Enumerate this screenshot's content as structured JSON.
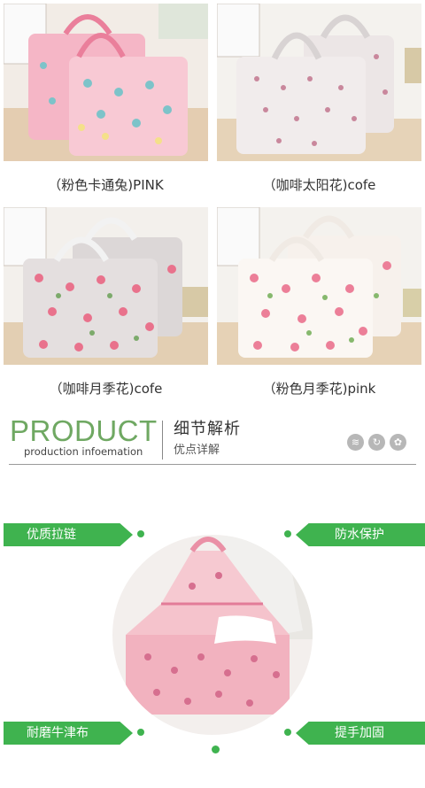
{
  "products": [
    {
      "caption": "（粉色卡通兔)PINK"
    },
    {
      "caption": "（咖啡太阳花)cofe"
    },
    {
      "caption": "（咖啡月季花)cofe"
    },
    {
      "caption": "（粉色月季花)pink"
    }
  ],
  "section_header": {
    "title": "PRODUCT",
    "subtitle": "production infoemation",
    "title_cn": "细节解析",
    "subtitle_cn": "优点详解",
    "icons": [
      "wave-icon",
      "refresh-icon",
      "flower-icon"
    ]
  },
  "features": {
    "top_left": "优质拉链",
    "top_right": "防水保护",
    "bottom_left": "耐磨牛津布",
    "bottom_right": "提手加固"
  },
  "colors": {
    "accent_green": "#3fb34f",
    "heading_green": "#6fa862",
    "bag_pink": "#f4c0ca"
  }
}
